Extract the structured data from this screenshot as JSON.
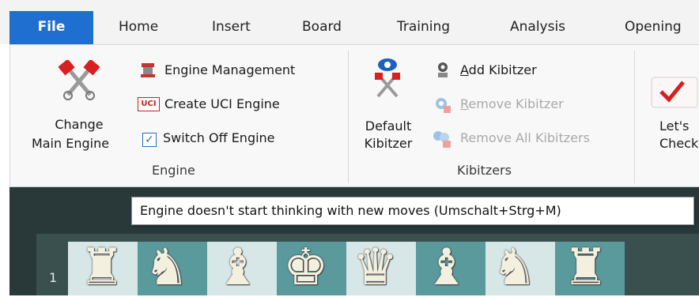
{
  "tabs": [
    {
      "label": "File"
    },
    {
      "label": "Home"
    },
    {
      "label": "Insert"
    },
    {
      "label": "Board"
    },
    {
      "label": "Training"
    },
    {
      "label": "Analysis"
    },
    {
      "label": "Opening"
    }
  ],
  "engine_group": {
    "change_main_engine_line1": "Change",
    "change_main_engine_line2": "Main Engine",
    "engine_management": "Engine Management",
    "create_uci_engine": "Create UCI Engine",
    "switch_off_engine": "Switch Off Engine",
    "switch_off_checked": true,
    "group_label": "Engine",
    "uci_badge": "UCI"
  },
  "kibitzers_group": {
    "default_kibitzer_line1": "Default",
    "default_kibitzer_line2": "Kibitzer",
    "add_kibitzer_first": "A",
    "add_kibitzer_rest": "dd Kibitzer",
    "remove_kibitzer_first": "R",
    "remove_kibitzer_rest": "emove Kibitzer",
    "remove_all_kibitzers": "Remove All Kibitzers",
    "group_label": "Kibitzers"
  },
  "lets_check": {
    "line1": "Let's",
    "line2": "Check"
  },
  "tooltip": {
    "text": "Engine doesn't start thinking with new moves (Umschalt+Strg+M)"
  },
  "board": {
    "rank_label": "1",
    "pieces": [
      "♜",
      "♞",
      "♝",
      "♚",
      "♛",
      "♝",
      "♞",
      "♜"
    ]
  }
}
